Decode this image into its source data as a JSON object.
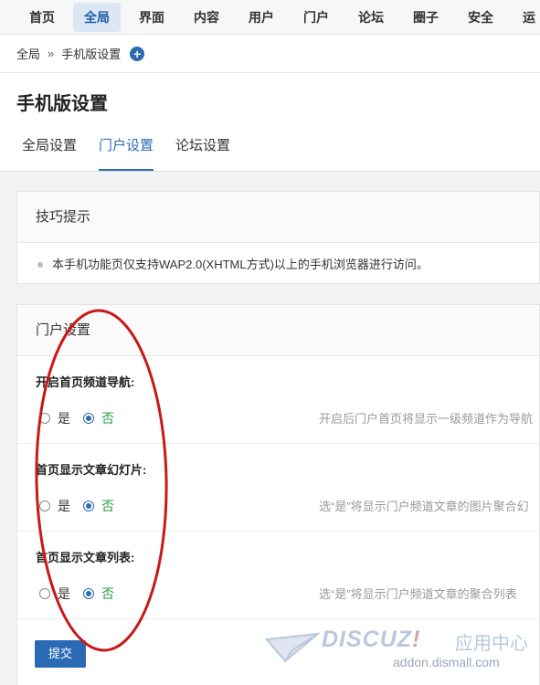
{
  "topnav": {
    "items": [
      {
        "label": "首页",
        "active": false
      },
      {
        "label": "全局",
        "active": true
      },
      {
        "label": "界面",
        "active": false
      },
      {
        "label": "内容",
        "active": false
      },
      {
        "label": "用户",
        "active": false
      },
      {
        "label": "门户",
        "active": false
      },
      {
        "label": "论坛",
        "active": false
      },
      {
        "label": "圈子",
        "active": false
      },
      {
        "label": "安全",
        "active": false
      },
      {
        "label": "运",
        "active": false
      }
    ]
  },
  "breadcrumb": {
    "root": "全局",
    "separator": "»",
    "current": "手机版设置",
    "add_icon": "+"
  },
  "page": {
    "title": "手机版设置",
    "tabs": [
      {
        "label": "全局设置",
        "active": false
      },
      {
        "label": "门户设置",
        "active": true
      },
      {
        "label": "论坛设置",
        "active": false
      }
    ]
  },
  "tips": {
    "title": "技巧提示",
    "text": "本手机功能页仅支持WAP2.0(XHTML方式)以上的手机浏览器进行访问。"
  },
  "portal_settings": {
    "title": "门户设置",
    "rows": [
      {
        "label": "开启首页频道导航:",
        "yes": "是",
        "no": "否",
        "selected": "no",
        "desc": "开启后门户首页将显示一级频道作为导航"
      },
      {
        "label": "首页显示文章幻灯片:",
        "yes": "是",
        "no": "否",
        "selected": "no",
        "desc": "选“是”将显示门户频道文章的图片聚合幻"
      },
      {
        "label": "首页显示文章列表:",
        "yes": "是",
        "no": "否",
        "selected": "no",
        "desc": "选“是”将显示门户频道文章的聚合列表"
      }
    ],
    "submit_label": "提交"
  },
  "watermark": {
    "brand": "DISCUZ",
    "exclaim": "!",
    "cn": "应用中心",
    "url": "addon.dismall.com"
  },
  "colors": {
    "accent": "#2b6cb0",
    "annotation": "#c81818",
    "selected_text": "#2aa14a"
  }
}
